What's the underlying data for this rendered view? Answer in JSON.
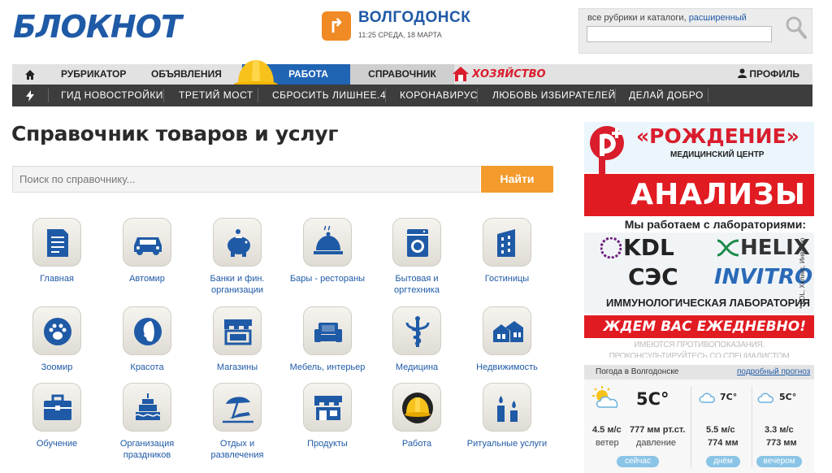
{
  "header": {
    "logo": "БЛОКНОТ",
    "city": "ВОЛГОДОНСК",
    "datetime": "11:25 СРЕДА, 18 МАРТА",
    "search_hint": "все рубрики и каталоги,",
    "search_advanced": "расширенный"
  },
  "nav_primary": [
    {
      "label": "РУБРИКАТОР"
    },
    {
      "label": "ОБЪЯВЛЕНИЯ"
    },
    {
      "label": "РАБОТА"
    },
    {
      "label": "СПРАВОЧНИК"
    },
    {
      "label": "ХОЗЯЙСТВО"
    }
  ],
  "profile_label": "ПРОФИЛЬ",
  "nav_secondary": [
    {
      "label": "ГИД НОВОСТРОЙКИ"
    },
    {
      "label": "ТРЕТИЙ МОСТ"
    },
    {
      "label": "СБРОСИТЬ ЛИШНЕЕ.4"
    },
    {
      "label": "КОРОНАВИРУС"
    },
    {
      "label": "ЛЮБОВЬ ИЗБИРАТЕЛЕЙ"
    },
    {
      "label": "ДЕЛАЙ ДОБРО"
    }
  ],
  "main": {
    "title": "Справочник товаров и услуг",
    "search_placeholder": "Поиск по справочнику...",
    "search_button": "Найти"
  },
  "categories": [
    {
      "label": "Главная",
      "icon": "document-icon"
    },
    {
      "label": "Автомир",
      "icon": "car-icon"
    },
    {
      "label": "Банки и фин. организации",
      "icon": "piggy-bank-icon"
    },
    {
      "label": "Бары - рестораны",
      "icon": "cloche-icon"
    },
    {
      "label": "Бытовая и оргтехника",
      "icon": "washing-machine-icon"
    },
    {
      "label": "Гостиницы",
      "icon": "building-icon"
    },
    {
      "label": "Зоомир",
      "icon": "paw-icon"
    },
    {
      "label": "Красота",
      "icon": "face-icon"
    },
    {
      "label": "Магазины",
      "icon": "shop-icon"
    },
    {
      "label": "Мебель, интерьер",
      "icon": "sofa-icon"
    },
    {
      "label": "Медицина",
      "icon": "caduceus-icon"
    },
    {
      "label": "Недвижимость",
      "icon": "houses-icon"
    },
    {
      "label": "Обучение",
      "icon": "briefcase-icon"
    },
    {
      "label": "Организация праздников",
      "icon": "cake-icon"
    },
    {
      "label": "Отдых и развлечения",
      "icon": "beach-umbrella-icon"
    },
    {
      "label": "Продукты",
      "icon": "store-icon"
    },
    {
      "label": "Работа",
      "icon": "hard-hat-icon"
    },
    {
      "label": "Ритуальные услуги",
      "icon": "candles-icon"
    }
  ],
  "ad": {
    "brand": "«РОЖДЕНИЕ»",
    "subtitle": "МЕДИЦИНСКИЙ ЦЕНТР",
    "headline": "АНАЛИЗЫ",
    "labs_title": "Мы работаем с лабораториями:",
    "labs": [
      "KDL",
      "HELIX",
      "СЭС",
      "INVITRO"
    ],
    "labs_note": "* KDL, Хеликс, Инвитро",
    "immuno": "ИММУНОЛОГИЧЕСКАЯ ЛАБОРАТОРИЯ",
    "cta": "ЖДЕМ ВАС ЕЖЕДНЕВНО!",
    "warning": "ИМЕЮТСЯ ПРОТИВОПОКАЗАНИЯ. ПРОКОНСУЛЬТИРУЙТЕСЬ СО СПЕЦИАЛИСТОМ"
  },
  "weather": {
    "title": "Погода в Волгодонске",
    "link": "подробный прогноз",
    "now": {
      "temp": "5С°",
      "wind": "4.5 м/с",
      "wind_label": "ветер",
      "pressure": "777 мм рт.ст.",
      "pressure_label": "давление",
      "badge": "сейчас"
    },
    "day": {
      "temp": "7С°",
      "wind": "5.5 м/с",
      "pressure": "774 мм",
      "badge": "днём"
    },
    "evening": {
      "temp": "5С°",
      "wind": "3.3 м/с",
      "pressure": "773 мм",
      "badge": "вечером"
    }
  }
}
